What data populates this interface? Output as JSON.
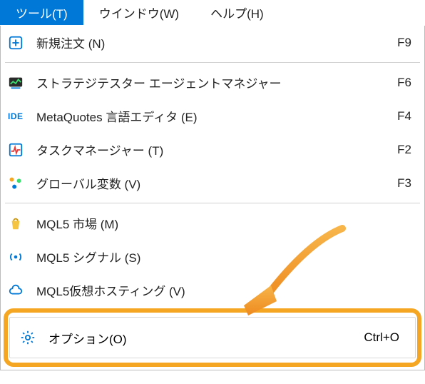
{
  "menubar": {
    "tools": "ツール(T)",
    "window": "ウインドウ(W)",
    "help": "ヘルプ(H)"
  },
  "menu": {
    "new_order": {
      "label": "新規注文 (N)",
      "shortcut": "F9"
    },
    "strategy_tester": {
      "label": "ストラテジテスター エージェントマネジャー",
      "shortcut": "F6"
    },
    "metaquotes": {
      "label": "MetaQuotes 言語エディタ (E)",
      "shortcut": "F4"
    },
    "task_manager": {
      "label": "タスクマネージャー (T)",
      "shortcut": "F2"
    },
    "global_vars": {
      "label": "グローバル変数 (V)",
      "shortcut": "F3"
    },
    "mql5_market": {
      "label": "MQL5 市場 (M)",
      "shortcut": ""
    },
    "mql5_signals": {
      "label": "MQL5 シグナル (S)",
      "shortcut": ""
    },
    "mql5_hosting": {
      "label": "MQL5仮想ホスティング (V)",
      "shortcut": ""
    },
    "options": {
      "label": "オプション(O)",
      "shortcut": "Ctrl+O"
    }
  }
}
